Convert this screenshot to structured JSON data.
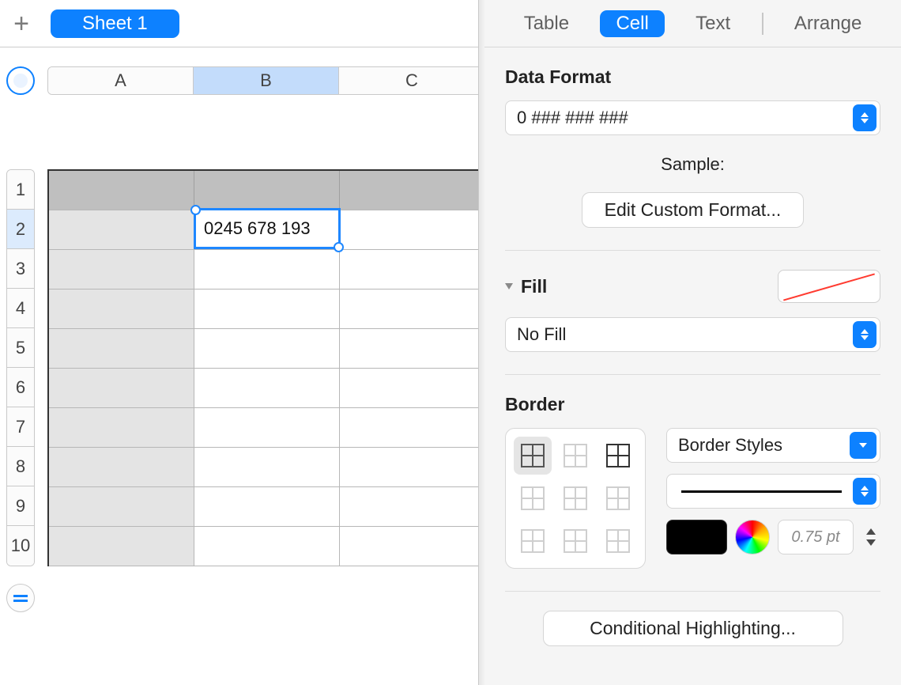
{
  "sheet": {
    "tab_label": "Sheet 1",
    "columns": [
      "A",
      "B",
      "C"
    ],
    "rows": [
      "1",
      "2",
      "3",
      "4",
      "5",
      "6",
      "7",
      "8",
      "9",
      "10"
    ],
    "selected_col_index": 1,
    "selected_row_index": 1,
    "selected_cell_value": "0245 678 193"
  },
  "inspector": {
    "tabs": {
      "table": "Table",
      "cell": "Cell",
      "text": "Text",
      "arrange": "Arrange"
    },
    "data_format": {
      "label": "Data Format",
      "format_string": "0 ### ### ###",
      "sample_label": "Sample:",
      "edit_button": "Edit Custom Format..."
    },
    "fill": {
      "label": "Fill",
      "value": "No Fill"
    },
    "border": {
      "label": "Border",
      "styles_label": "Border Styles",
      "weight": "0.75 pt",
      "color": "#000000"
    },
    "conditional_highlighting_label": "Conditional Highlighting..."
  }
}
